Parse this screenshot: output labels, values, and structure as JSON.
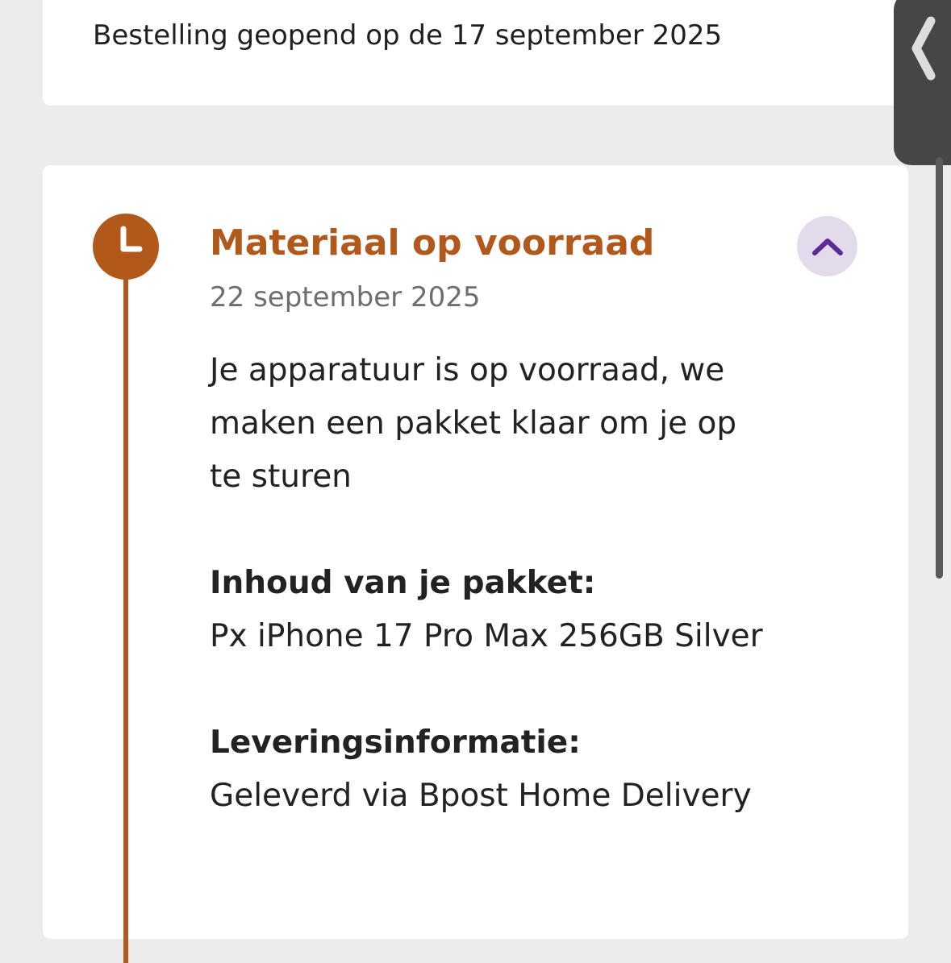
{
  "order": {
    "opened_text": "Bestelling geopend op de 17 september 2025"
  },
  "timeline_step": {
    "icon": "clock-icon",
    "title": "Materiaal op voorraad",
    "date": "22 september 2025",
    "description": "Je apparatuur is op voorraad, we maken een pakket klaar om je op te sturen",
    "contents_label": "Inhoud van je pakket:",
    "contents_value": "Px iPhone 17 Pro Max 256GB Silver",
    "delivery_label": "Leveringsinformatie:",
    "delivery_value": "Geleverd via Bpost Home Delivery",
    "collapse_icon": "chevron-up-icon"
  },
  "side_panel": {
    "handle_icon": "chevron-left-icon"
  },
  "colors": {
    "accent": "#b1581b",
    "button_bg": "#e3dbec",
    "chevron": "#5b2d91",
    "background": "#ececec"
  }
}
